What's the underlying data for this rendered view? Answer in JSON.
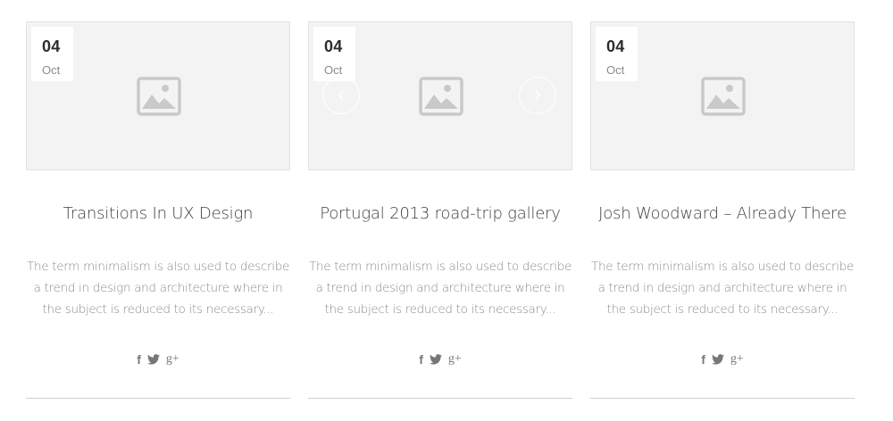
{
  "posts": [
    {
      "day": "04",
      "month": "Oct",
      "title": "Transitions In UX Design",
      "excerpt_lines": [
        "The term minimalism is also used to describe",
        "a trend in design and architecture where in",
        "the subject is reduced to its necessary..."
      ],
      "has_slider": false
    },
    {
      "day": "04",
      "month": "Oct",
      "title": "Portugal 2013 road-trip gallery",
      "excerpt_lines": [
        "The term minimalism is also used to describe",
        "a trend in design and architecture where in",
        "the subject is reduced to its necessary..."
      ],
      "has_slider": true
    },
    {
      "day": "04",
      "month": "Oct",
      "title": "Josh Woodward – Already There",
      "excerpt_lines": [
        "The term minimalism is also used to describe",
        "a trend in design and architecture where in",
        "the subject is reduced to its necessary..."
      ],
      "has_slider": false
    }
  ],
  "social_glyphs": {
    "facebook": "f",
    "twitter": "❧",
    "googleplus": "g+"
  },
  "colors": {
    "thumb_bg": "#f3f3f3",
    "placeholder_icon": "#c9c9c9",
    "title": "#3f3f3f",
    "excerpt": "#8c8c8c",
    "rule": "#cfcfcf"
  }
}
